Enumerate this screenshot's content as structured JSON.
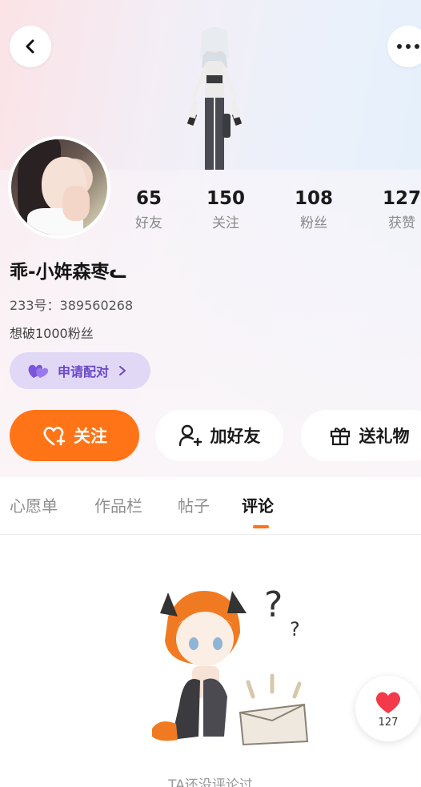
{
  "profile": {
    "nickname": "乖-小姩森枣ᓚ",
    "uid": "233号：389560268",
    "bio": "想破1000粉丝"
  },
  "stats": [
    {
      "value": "65",
      "label": "好友"
    },
    {
      "value": "150",
      "label": "关注"
    },
    {
      "value": "108",
      "label": "粉丝"
    },
    {
      "value": "127",
      "label": "获赞"
    }
  ],
  "pair_button": {
    "label": "申请配对"
  },
  "actions": {
    "follow": "关注",
    "add_friend": "加好友",
    "send_gift": "送礼物"
  },
  "tabs": [
    "心愿单",
    "作品栏",
    "帖子",
    "评论"
  ],
  "active_tab": "评论",
  "empty_state": {
    "text": "TA还没评论过"
  },
  "like_float": {
    "count": "127"
  },
  "colors": {
    "accent": "#ff7416",
    "pair_bg": "#e1d8f6",
    "pair_text": "#6a48c4",
    "heart": "#f23a4a"
  },
  "icons": {
    "back": "back-arrow-icon",
    "more": "more-dots-icon",
    "pair": "hearts-icon",
    "follow": "heart-plus-icon",
    "add_friend": "person-plus-icon",
    "gift": "gift-icon",
    "like": "heart-icon"
  }
}
